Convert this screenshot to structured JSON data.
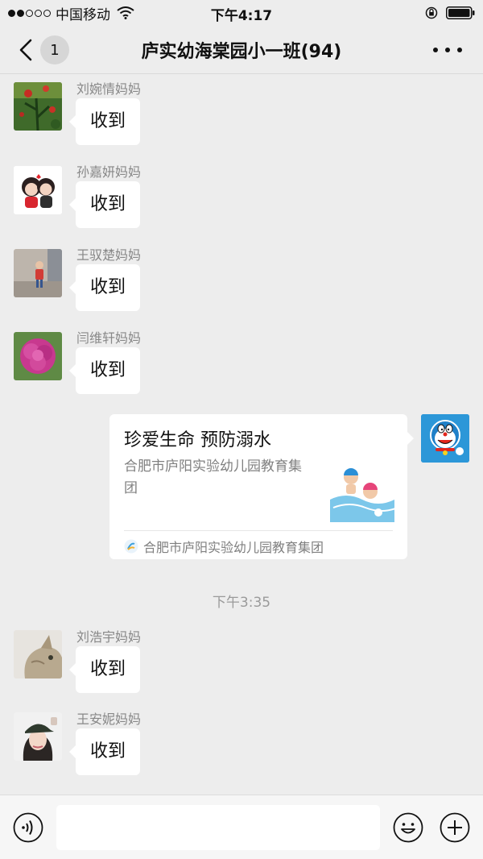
{
  "status_bar": {
    "carrier": "中国移动",
    "time": "下午4:17"
  },
  "nav": {
    "back_badge": "1",
    "title": "庐实幼海棠园小一班(94)"
  },
  "messages": [
    {
      "sender": "刘婉情妈妈",
      "text": "收到"
    },
    {
      "sender": "孙嘉妍妈妈",
      "text": "收到"
    },
    {
      "sender": "王驭楚妈妈",
      "text": "收到"
    },
    {
      "sender": "闫维轩妈妈",
      "text": "收到"
    }
  ],
  "link_card": {
    "title": "珍爱生命  预防溺水",
    "description": "合肥市庐阳实验幼儿园教育集团",
    "source": "合肥市庐阳实验幼儿园教育集团"
  },
  "time_divider": "下午3:35",
  "messages_after": [
    {
      "sender": "刘浩宇妈妈",
      "text": "收到"
    },
    {
      "sender": "王安妮妈妈",
      "text": "收到"
    }
  ],
  "input": {
    "placeholder": ""
  }
}
